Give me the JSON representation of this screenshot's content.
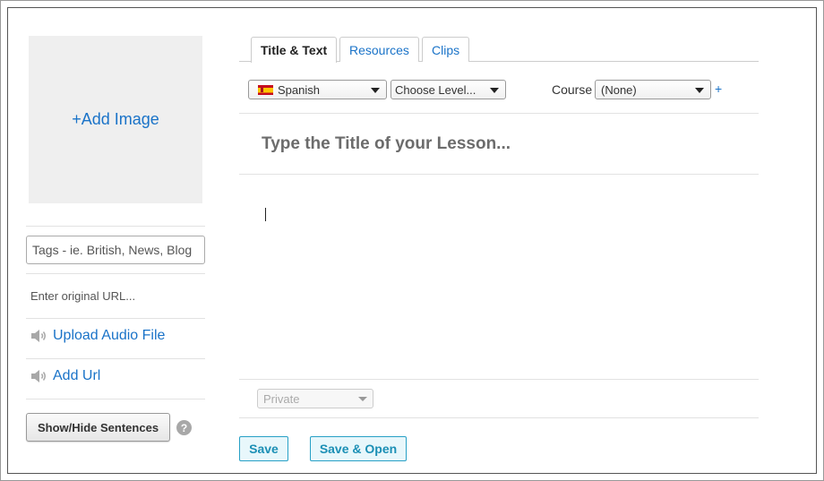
{
  "sidebar": {
    "add_image": "+Add Image",
    "tags_placeholder": "Tags - ie. British, News, Blog",
    "url_placeholder": "Enter original URL...",
    "upload_audio": "Upload Audio File",
    "add_url": "Add Url",
    "show_hide": "Show/Hide Sentences",
    "help": "?"
  },
  "tabs": [
    {
      "label": "Title & Text",
      "active": true
    },
    {
      "label": "Resources",
      "active": false
    },
    {
      "label": "Clips",
      "active": false
    }
  ],
  "toolbar": {
    "language": "Spanish",
    "level": "Choose Level...",
    "course_label": "Course",
    "course_value": "(None)",
    "add_course": "+"
  },
  "editor": {
    "title_placeholder": "Type the Title of your Lesson...",
    "text_value": ""
  },
  "footer": {
    "privacy": "Private",
    "save": "Save",
    "save_open": "Save & Open"
  },
  "colors": {
    "link": "#1a73c8",
    "save_border": "#27a0c6",
    "save_bg": "#e8f7fb"
  }
}
